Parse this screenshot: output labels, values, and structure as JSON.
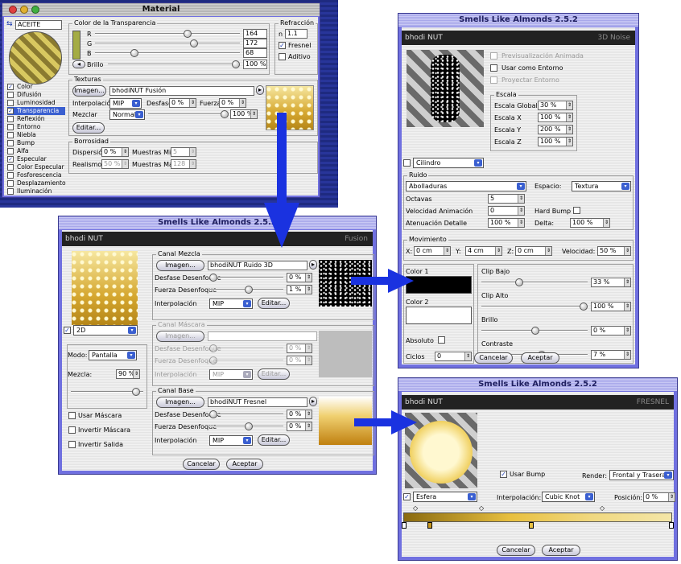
{
  "material": {
    "title": "Material",
    "name": "ACEITE",
    "color_transp_title": "Color de la Transparencia",
    "r_label": "R",
    "r_value": "164",
    "g_label": "G",
    "g_value": "172",
    "b_label": "B",
    "b_value": "68",
    "brillo_label": "Brillo",
    "brillo_value": "100 %",
    "refraccion_title": "Refracción",
    "n_label": "n",
    "n_value": "1.1",
    "fresnel_label": "Fresnel",
    "aditivo_label": "Aditivo",
    "texturas_title": "Texturas",
    "imagen_button": "Imagen...",
    "texture_name": "bhodiNUT Fusión",
    "interp_label": "Interpolación",
    "interp_value": "MIP",
    "desfase_label": "Desfase",
    "desfase_value": "0 %",
    "fuerza_label": "Fuerza",
    "fuerza_value": "0 %",
    "mezclar_label": "Mezclar",
    "mezclar_value": "Normal",
    "mezclar_pct": "100 %",
    "editar_button": "Editar...",
    "borrosidad_title": "Borrosidad",
    "dispersion_label": "Dispersión",
    "dispersion_value": "0 %",
    "muestras_min_label": "Muestras Min",
    "muestras_min_value": "5",
    "realismo_label": "Realismo",
    "realismo_value": "50 %",
    "muestras_max_label": "Muestras Max",
    "muestras_max_value": "128",
    "channels": [
      {
        "label": "Color",
        "on": true
      },
      {
        "label": "Difusión",
        "on": false
      },
      {
        "label": "Luminosidad",
        "on": false
      },
      {
        "label": "Transparencia",
        "on": true,
        "selected": true
      },
      {
        "label": "Reflexión",
        "on": false
      },
      {
        "label": "Entorno",
        "on": false
      },
      {
        "label": "Niebla",
        "on": false
      },
      {
        "label": "Bump",
        "on": false
      },
      {
        "label": "Alfa",
        "on": false
      },
      {
        "label": "Especular",
        "on": true
      },
      {
        "label": "Color Especular",
        "on": false
      },
      {
        "label": "Fosforescencia",
        "on": false
      },
      {
        "label": "Desplazamiento",
        "on": false
      },
      {
        "label": "Iluminación",
        "on": false
      }
    ]
  },
  "fusion": {
    "title": "Smells Like Almonds 2.5.2",
    "logo": "bhodi NUT",
    "header_right": "Fusion",
    "mezcla_title": "Canal Mezcla",
    "imagen_button": "Imagen...",
    "mezcla_name": "bhodiNUT Ruido 3D",
    "desfase_desenfoque_label": "Desfase Desenfoque",
    "fuerza_desenfoque_label": "Fuerza Desenfoque",
    "interp_label": "Interpolación",
    "mezcla_desfase": "0 %",
    "mezcla_fuerza": "1 %",
    "mezcla_interp": "MIP",
    "editar_button": "Editar...",
    "mascara_title": "Canal Máscara",
    "mascara_desfase": "0 %",
    "mascara_fuerza": "0 %",
    "mascara_interp": "MIP",
    "base_title": "Canal Base",
    "base_name": "bhodiNUT Fresnel",
    "base_desfase": "0 %",
    "base_fuerza": "0 %",
    "base_interp": "MIP",
    "mode2d": "2D",
    "modo_label": "Modo:",
    "modo_value": "Pantalla",
    "mezcla_label": "Mezcla:",
    "mezcla_value": "90 %",
    "usar_mascara": "Usar Máscara",
    "invertir_mascara": "Invertir Máscara",
    "invertir_salida": "Invertir Salida",
    "cancelar": "Cancelar",
    "aceptar": "Aceptar"
  },
  "noise": {
    "title": "Smells Like Almonds 2.5.2",
    "logo": "bhodi NUT",
    "header_right": "3D Noise",
    "previsualizacion": "Previsualización Animada",
    "usar_entorno": "Usar como Entorno",
    "proyectar_entorno": "Proyectar Entorno",
    "escala_title": "Escala",
    "escala_global_label": "Escala Global",
    "escala_global_value": "30 %",
    "escala_x_label": "Escala X",
    "escala_x_value": "100 %",
    "escala_y_label": "Escala Y",
    "escala_y_value": "200 %",
    "escala_z_label": "Escala Z",
    "escala_z_value": "100 %",
    "shape": "Cilindro",
    "ruido_title": "Ruido",
    "ruido_type": "Abolladuras",
    "espacio_label": "Espacio:",
    "espacio_value": "Textura",
    "octavas_label": "Octavas",
    "octavas_value": "5",
    "velocidad_anim_label": "Velocidad Animación",
    "velocidad_anim_value": "0",
    "hard_bump_label": "Hard Bump",
    "atenuacion_label": "Atenuación Detalle",
    "atenuacion_value": "100 %",
    "delta_label": "Delta:",
    "delta_value": "100 %",
    "movimiento_title": "Movimiento",
    "x_label": "X:",
    "x_value": "0 cm",
    "y_label": "Y:",
    "y_value": "4 cm",
    "z_label": "Z:",
    "z_value": "0 cm",
    "velocidad_label": "Velocidad:",
    "velocidad_value": "50 %",
    "color1_label": "Color 1",
    "color2_label": "Color 2",
    "absoluto_label": "Absoluto",
    "ciclos_label": "Ciclos",
    "ciclos_value": "0",
    "clip_bajo_label": "Clip Bajo",
    "clip_bajo_value": "33 %",
    "clip_alto_label": "Clip Alto",
    "clip_alto_value": "100 %",
    "brillo_label": "Brillo",
    "brillo_value": "0 %",
    "contraste_label": "Contraste",
    "contraste_value": "7 %",
    "cancelar": "Cancelar",
    "aceptar": "Aceptar"
  },
  "fresnel": {
    "title": "Smells Like Almonds 2.5.2",
    "logo": "bhodi NUT",
    "header_right": "FRESNEL",
    "usar_bump_label": "Usar Bump",
    "render_label": "Render:",
    "render_value": "Frontal y Trasera",
    "shape": "Esfera",
    "interp_label": "Interpolación:",
    "interp_value": "Cubic Knot",
    "posicion_label": "Posición:",
    "posicion_value": "0 %",
    "cancelar": "Cancelar",
    "aceptar": "Aceptar"
  },
  "colors": {
    "window_frame": "#7070e0",
    "arrow": "#1a32e0",
    "transp_swatch": "#a4ac44",
    "desktop": "#223090"
  }
}
